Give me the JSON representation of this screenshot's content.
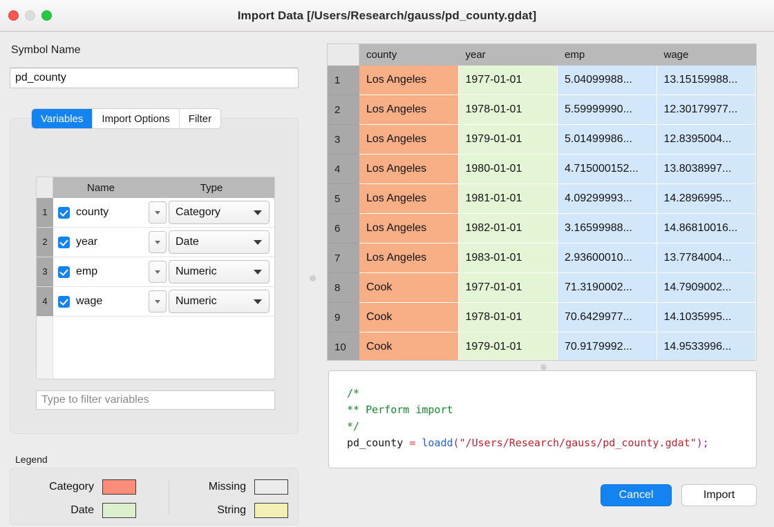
{
  "window": {
    "title": "Import Data [/Users/Research/gauss/pd_county.gdat]",
    "lights": {
      "close": "close-button",
      "minimize": "minimize-button",
      "zoom": "zoom-button"
    }
  },
  "left": {
    "symbol_name_label": "Symbol Name",
    "symbol_name_value": "pd_county",
    "tabs": [
      {
        "label": "Variables",
        "active": true
      },
      {
        "label": "Import Options",
        "active": false
      },
      {
        "label": "Filter",
        "active": false
      }
    ],
    "variables_table": {
      "headers": {
        "row": "",
        "name": "Name",
        "type": "Type"
      },
      "rows": [
        {
          "num": "1",
          "checked": true,
          "name": "county",
          "type": "Category"
        },
        {
          "num": "2",
          "checked": true,
          "name": "year",
          "type": "Date"
        },
        {
          "num": "3",
          "checked": true,
          "name": "emp",
          "type": "Numeric"
        },
        {
          "num": "4",
          "checked": true,
          "name": "wage",
          "type": "Numeric"
        }
      ]
    },
    "filter_placeholder": "Type to filter variables",
    "legend": {
      "title": "Legend",
      "left_items": [
        {
          "label": "Category",
          "color": "#fa8c7a"
        },
        {
          "label": "Date",
          "color": "#dcf0d0"
        }
      ],
      "right_items": [
        {
          "label": "Missing",
          "color": "#ececec"
        },
        {
          "label": "String",
          "color": "#f2f0b4"
        }
      ]
    }
  },
  "data_table": {
    "columns": [
      "county",
      "year",
      "emp",
      "wage"
    ],
    "column_colors": [
      "#f8af85",
      "#e3f5d4",
      "#d3e7fa",
      "#d3e7fa"
    ],
    "rows": [
      {
        "num": "1",
        "county": "Los Angeles",
        "year": "1977-01-01",
        "emp": "5.04099988...",
        "wage": "13.15159988..."
      },
      {
        "num": "2",
        "county": "Los Angeles",
        "year": "1978-01-01",
        "emp": "5.59999990...",
        "wage": "12.30179977..."
      },
      {
        "num": "3",
        "county": "Los Angeles",
        "year": "1979-01-01",
        "emp": "5.01499986...",
        "wage": "12.8395004..."
      },
      {
        "num": "4",
        "county": "Los Angeles",
        "year": "1980-01-01",
        "emp": "4.715000152...",
        "wage": "13.8038997..."
      },
      {
        "num": "5",
        "county": "Los Angeles",
        "year": "1981-01-01",
        "emp": "4.09299993...",
        "wage": "14.2896995..."
      },
      {
        "num": "6",
        "county": "Los Angeles",
        "year": "1982-01-01",
        "emp": "3.16599988...",
        "wage": "14.86810016..."
      },
      {
        "num": "7",
        "county": "Los Angeles",
        "year": "1983-01-01",
        "emp": "2.93600010...",
        "wage": "13.7784004..."
      },
      {
        "num": "8",
        "county": "Cook",
        "year": "1977-01-01",
        "emp": "71.3190002...",
        "wage": "14.7909002..."
      },
      {
        "num": "9",
        "county": "Cook",
        "year": "1978-01-01",
        "emp": "70.6429977...",
        "wage": "14.1035995..."
      },
      {
        "num": "10",
        "county": "Cook",
        "year": "1979-01-01",
        "emp": "70.9179992...",
        "wage": "14.9533996..."
      }
    ]
  },
  "code_preview": {
    "line1": "/*",
    "line2": "** Perform import",
    "line3": "*/",
    "line4_ident": "pd_county",
    "line4_eq": "=",
    "line4_fn": "loadd",
    "line4_open": "(",
    "line4_string": "\"/Users/Research/gauss/pd_county.gdat\"",
    "line4_close": ");"
  },
  "buttons": {
    "cancel": "Cancel",
    "import": "Import"
  },
  "colors": {
    "accent": "#1383f2",
    "category": "#f8af85",
    "date": "#e3f5d4",
    "numeric": "#d3e7fa"
  }
}
